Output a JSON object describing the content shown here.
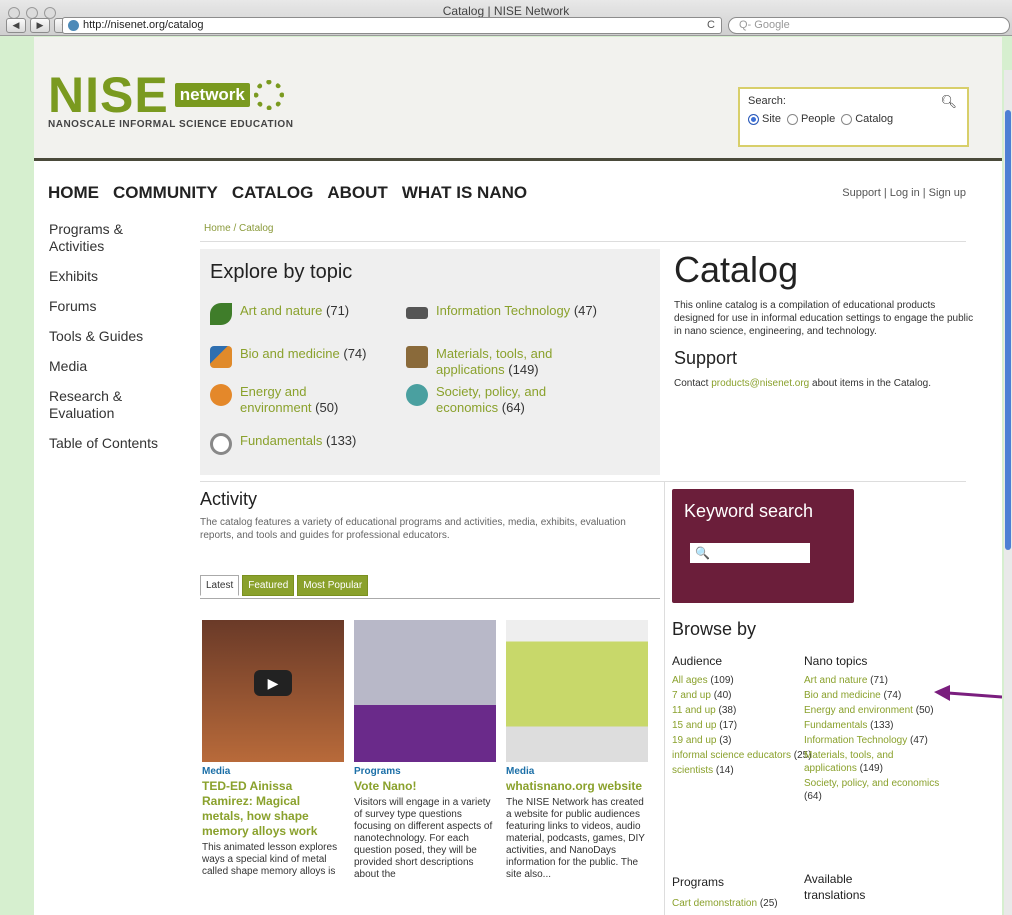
{
  "browser": {
    "window_title": "Catalog | NISE Network",
    "url": "http://nisenet.org/catalog",
    "search_placeholder": "Q- Google",
    "back": "◀",
    "forward": "▶",
    "add": "+",
    "reload": "C"
  },
  "header": {
    "logo_nise": "NISE",
    "logo_network": "network",
    "logo_sub": "NANOSCALE INFORMAL SCIENCE EDUCATION",
    "search_label": "Search:",
    "radios": [
      "Site",
      "People",
      "Catalog"
    ],
    "radio_selected": "Site"
  },
  "nav": {
    "main": [
      "HOME",
      "COMMUNITY",
      "CATALOG",
      "ABOUT",
      "WHAT IS NANO"
    ],
    "user": "Support | Log in | Sign up"
  },
  "sidebar": [
    "Programs & Activities",
    "Exhibits",
    "Forums",
    "Tools & Guides",
    "Media",
    "Research & Evaluation",
    "Table of Contents"
  ],
  "breadcrumb": "Home / Catalog",
  "explore": {
    "title": "Explore by topic",
    "topics": [
      {
        "name": "Art and nature",
        "count": "(71)"
      },
      {
        "name": "Bio and medicine",
        "count": "(74)"
      },
      {
        "name": "Energy and environment",
        "count": "(50)"
      },
      {
        "name": "Fundamentals",
        "count": "(133)"
      },
      {
        "name": "Information Technology",
        "count": "(47)"
      },
      {
        "name": "Materials, tools, and applications",
        "count": "(149)"
      },
      {
        "name": "Society, policy, and economics",
        "count": "(64)"
      }
    ]
  },
  "catalog": {
    "title": "Catalog",
    "desc": "This online catalog is a compilation of educational products designed for use in informal education settings to engage the public in nano science, engineering, and technology.",
    "support_title": "Support",
    "support_pre": "Contact",
    "support_email": "products@nisenet.org",
    "support_post": "about items in the Catalog."
  },
  "activity": {
    "title": "Activity",
    "desc": "The catalog features a variety of educational programs and activities, media, exhibits, evaluation reports, and tools and guides for professional educators.",
    "tabs": [
      "Latest",
      "Featured",
      "Most Popular"
    ],
    "cards": [
      {
        "type": "Media",
        "title": "TED-ED Ainissa Ramirez: Magical metals, how shape memory alloys work",
        "desc": "This animated lesson explores ways a special kind of metal called shape memory alloys is"
      },
      {
        "type": "Programs",
        "title": "Vote Nano!",
        "desc": "Visitors will engage in a variety of survey type questions focusing on different aspects of nanotechnology. For each question posed, they will be provided short descriptions about the"
      },
      {
        "type": "Media",
        "title": "whatisnano.org website",
        "desc": "The NISE Network has created a website for public audiences featuring links to videos, audio material, podcasts, games, DIY activities, and NanoDays information for the public. The site also..."
      }
    ]
  },
  "keyword": {
    "title": "Keyword search",
    "icon": "🔍"
  },
  "browse": {
    "title": "Browse by",
    "audience_title": "Audience",
    "audience": [
      {
        "l": "All ages",
        "c": "(109)"
      },
      {
        "l": "7 and up",
        "c": "(40)"
      },
      {
        "l": "11 and up",
        "c": "(38)"
      },
      {
        "l": "15 and up",
        "c": "(17)"
      },
      {
        "l": "19 and up",
        "c": "(3)"
      },
      {
        "l": "informal science educators",
        "c": "(25)"
      },
      {
        "l": "scientists",
        "c": "(14)"
      }
    ],
    "nano_title": "Nano topics",
    "nano": [
      {
        "l": "Art and nature",
        "c": "(71)"
      },
      {
        "l": "Bio and medicine",
        "c": "(74)"
      },
      {
        "l": "Energy and environment",
        "c": "(50)"
      },
      {
        "l": "Fundamentals",
        "c": "(133)"
      },
      {
        "l": "Information Technology",
        "c": "(47)"
      },
      {
        "l": "Materials, tools, and applications",
        "c": "(149)"
      },
      {
        "l": "Society, policy, and economics",
        "c": "(64)"
      }
    ],
    "programs_title": "Programs",
    "programs_first": {
      "l": "Cart demonstration",
      "c": "(25)"
    },
    "translations_title": "Available translations"
  },
  "colors": {
    "accent": "#8aa12c",
    "keyword_bg": "#6b1e3a",
    "arrow": "#7a1e7e"
  }
}
